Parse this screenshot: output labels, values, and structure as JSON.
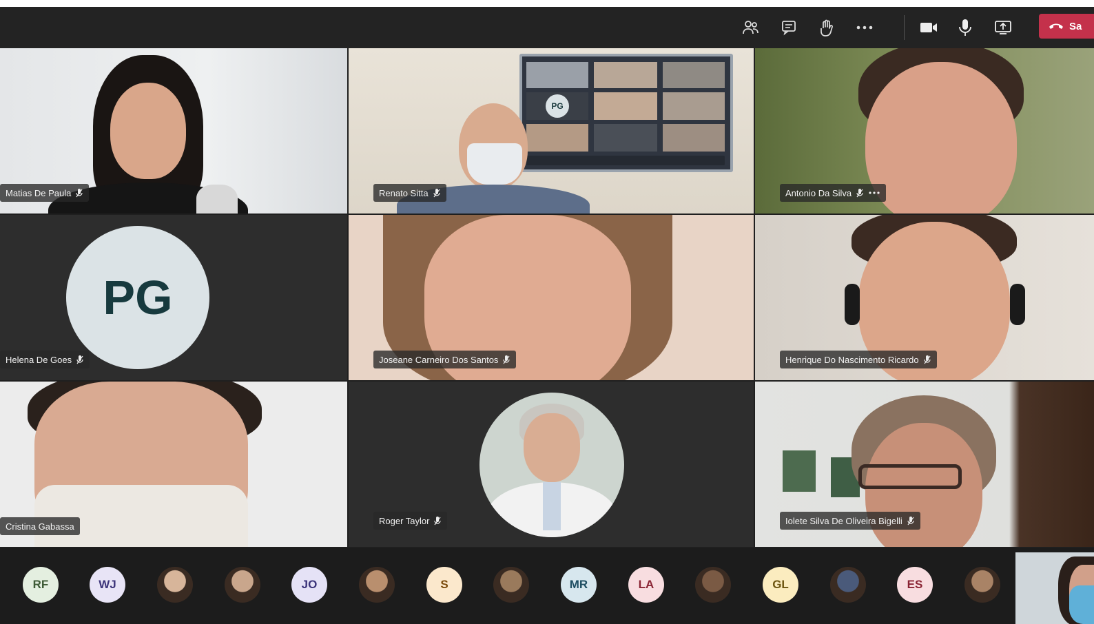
{
  "toolbar": {
    "leave_label": "Sa",
    "icons": [
      "participants-icon",
      "chat-icon",
      "raise-hand-icon",
      "more-icon",
      "camera-icon",
      "mic-icon",
      "share-screen-icon",
      "hang-up-icon"
    ],
    "leave_color": "#c4314b"
  },
  "tiles": [
    {
      "name": "Matias De Paula",
      "avatar": ""
    },
    {
      "name": "Renato Sitta",
      "avatar": ""
    },
    {
      "name": "Antonio Da Silva",
      "avatar": ""
    },
    {
      "name": "Helena De Goes",
      "avatar": "PG"
    },
    {
      "name": "Joseane Carneiro Dos Santos",
      "avatar": ""
    },
    {
      "name": "Henrique Do Nascimento Ricardo",
      "avatar": ""
    },
    {
      "name": "Cristina Gabassa",
      "avatar": ""
    },
    {
      "name": "Roger Taylor",
      "avatar": ""
    },
    {
      "name": "Iolete Silva De Oliveira Bigelli",
      "avatar": ""
    }
  ],
  "screen_avatar": "PG",
  "strip": [
    {
      "initials": "RF",
      "color": "#e4efe0",
      "text_color": "#3d5a35"
    },
    {
      "initials": "WJ",
      "color": "#e8e4f6",
      "text_color": "#3c3479"
    },
    {
      "initials": "",
      "color": "#d7b59a",
      "text_color": "#333"
    },
    {
      "initials": "",
      "color": "#c9a68c",
      "text_color": "#333"
    },
    {
      "initials": "JO",
      "color": "#e5e2f6",
      "text_color": "#3b347a"
    },
    {
      "initials": "",
      "color": "#b98f6e",
      "text_color": "#333"
    },
    {
      "initials": "S",
      "color": "#fbe8cc",
      "text_color": "#7a4a0b"
    },
    {
      "initials": "",
      "color": "#9a7a5c",
      "text_color": "#333"
    },
    {
      "initials": "MR",
      "color": "#d7e7ee",
      "text_color": "#1f4f63"
    },
    {
      "initials": "LA",
      "color": "#f8dde0",
      "text_color": "#8a2434"
    },
    {
      "initials": "",
      "color": "#7a5a44",
      "text_color": "#333"
    },
    {
      "initials": "GL",
      "color": "#fbecbf",
      "text_color": "#6d5510"
    },
    {
      "initials": "",
      "color": "#4a5a7a",
      "text_color": "#333"
    },
    {
      "initials": "ES",
      "color": "#f8dde0",
      "text_color": "#8a2434"
    },
    {
      "initials": "",
      "color": "#a98366",
      "text_color": "#333"
    }
  ]
}
